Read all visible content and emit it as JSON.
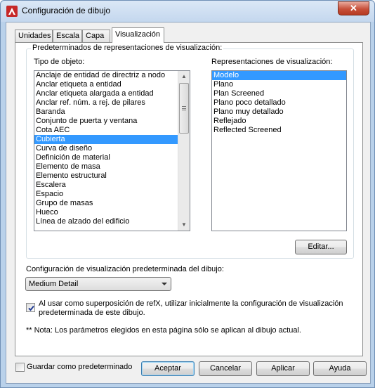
{
  "window": {
    "title": "Configuración de dibujo",
    "close_glyph": "✕"
  },
  "tabs": [
    {
      "label": "Unidades"
    },
    {
      "label": "Escala"
    },
    {
      "label": "Capa"
    },
    {
      "label": "Visualización",
      "active": true
    }
  ],
  "group": {
    "title": "Predeterminados de representaciones de visualización:",
    "object_type_label": "Tipo de objeto:",
    "representations_label": "Representaciones de visualización:"
  },
  "object_types": {
    "items": [
      "Anclaje de entidad de directriz a nodo",
      "Anclar etiqueta a entidad",
      "Anclar etiqueta alargada a entidad",
      "Anclar ref. núm. a rej. de pilares",
      "Baranda",
      "Conjunto de puerta y ventana",
      "Cota AEC",
      "Cubierta",
      "Curva de diseño",
      "Definición de material",
      "Elemento de masa",
      "Elemento estructural",
      "Escalera",
      "Espacio",
      "Grupo de masas",
      "Hueco",
      "Línea de alzado del edificio"
    ],
    "selected": "Cubierta",
    "scroll_up_icon": "▲",
    "scroll_down_icon": "▼"
  },
  "representations": {
    "items": [
      "Modelo",
      "Plano",
      "Plan Screened",
      "Plano poco detallado",
      "Plano muy detallado",
      "Reflejado",
      "Reflected Screened"
    ],
    "selected": "Modelo"
  },
  "edit_button": "Editar...",
  "default_config": {
    "label": "Configuración de visualización predeterminada del dibujo:",
    "value": "Medium Detail"
  },
  "xref_option": {
    "checked": true,
    "line1": "Al usar como superposición de refX, utilizar inicialmente la configuración de visualización",
    "line2": "predeterminada de este dibujo."
  },
  "note": "** Nota: Los parámetros elegidos en esta página sólo se aplican al dibujo actual.",
  "footer": {
    "save_default": {
      "label": "Guardar como predeterminado",
      "checked": false
    },
    "accept": "Aceptar",
    "cancel": "Cancelar",
    "apply": "Aplicar",
    "help": "Ayuda"
  },
  "colors": {
    "selection": "#3399ff",
    "title_bar": "#c4d7ee",
    "close_button": "#c7503a"
  }
}
